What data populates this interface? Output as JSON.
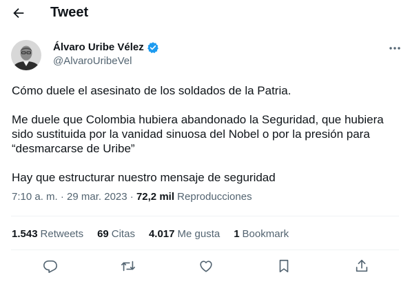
{
  "header": {
    "title": "Tweet"
  },
  "author": {
    "name": "Álvaro Uribe Vélez",
    "handle": "@AlvaroUribeVel",
    "verified_color": "#1d9bf0"
  },
  "tweet": {
    "paragraphs": [
      "Cómo duele el asesinato de los soldados de la Patria.",
      "Me duele que Colombia hubiera abandonado la Seguridad, que hubiera sido sustituida por la vanidad sinuosa del Nobel o por la presión para “desmarcarse de Uribe”",
      "Hay que estructurar nuestro mensaje de seguridad"
    ],
    "time": "7:10 a. m.",
    "separator": "·",
    "date": "29 mar. 2023",
    "views_count": "72,2 mil",
    "views_label": "Reproducciones"
  },
  "stats": {
    "retweets_count": "1.543",
    "retweets_label": "Retweets",
    "quotes_count": "69",
    "quotes_label": "Citas",
    "likes_count": "4.017",
    "likes_label": "Me gusta",
    "bookmarks_count": "1",
    "bookmarks_label": "Bookmark"
  },
  "icons": {
    "back": "arrow-left-icon",
    "verified": "verified-badge-icon",
    "more": "more-horizontal-icon",
    "reply": "reply-icon",
    "retweet": "retweet-icon",
    "like": "heart-icon",
    "bookmark": "bookmark-icon",
    "share": "share-icon"
  },
  "colors": {
    "text": "#0f1419",
    "secondary": "#536471",
    "accent": "#1d9bf0",
    "divider": "#eff3f4"
  }
}
